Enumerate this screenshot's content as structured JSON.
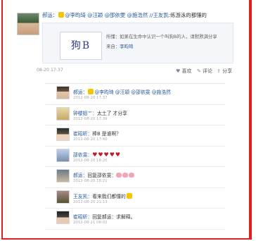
{
  "post": {
    "author": "郝运：",
    "mentions": "@李昀琦 @汪颖 @邵依雯 @施浩然",
    "repost_user": "//王友凯:",
    "repost_text": "练游泳的都懂的",
    "image_text": "狗B",
    "quote_line1": "所懂：如果在生命中认识一个叫狗B的人，请默默满分享",
    "quote_label2": "来自：",
    "quote_user2": "李昀琦",
    "time": "08-20 17:37",
    "like_label": "喜欢",
    "comment_label": "评论",
    "share_label": "分享"
  },
  "comments": [
    {
      "user": "郝运：",
      "text": "@李昀琦 @汪颖 @邵依雯 @施浩然",
      "time": "2012-08-20 17:37"
    },
    {
      "user": "钟楼姐™：",
      "text": "太土了 才分享",
      "time": "2012-08-20 17:39"
    },
    {
      "user": "崔昭昕：",
      "text": "棒B 是谁啊？",
      "time": "2012-08-20 17:40"
    },
    {
      "user": "邵依雯：",
      "text": "♥♥♥♥♥",
      "time": "2012-08-20 18:20"
    },
    {
      "user": "郝运：",
      "text": "回复邵依雯：",
      "time": "2012-08-20 18:21"
    },
    {
      "user": "王友凯：",
      "text": "看来我们都懂的",
      "time": "2012-08-20 21:13"
    },
    {
      "user": "崔昭昕：",
      "text": "回复郝运：求解释。",
      "time": "2012-08-21 08:02"
    }
  ],
  "colors": {
    "frame": "#e02020",
    "link": "#24599e"
  }
}
